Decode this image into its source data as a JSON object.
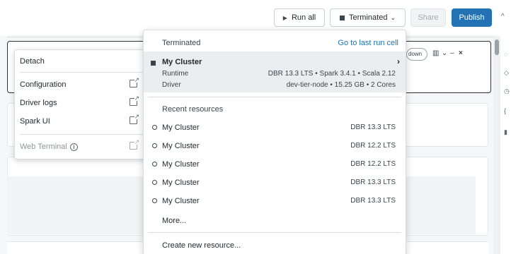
{
  "toolbar": {
    "run_all": "Run all",
    "cluster_status": "Terminated",
    "share": "Share",
    "publish": "Publish"
  },
  "attach_menu": {
    "items": [
      {
        "label": "Detach"
      },
      {
        "label": "Configuration"
      },
      {
        "label": "Driver logs"
      },
      {
        "label": "Spark UI"
      },
      {
        "label": "Web Terminal"
      }
    ]
  },
  "cluster_dropdown": {
    "status_header": "Terminated",
    "go_to_last_run": "Go to last run cell",
    "current": {
      "name": "My Cluster",
      "runtime_label": "Runtime",
      "runtime_value": "DBR 13.3 LTS • Spark 3.4.1 • Scala 2.12",
      "driver_label": "Driver",
      "driver_value": "dev-tier-node • 15.25 GB • 2 Cores"
    },
    "recent_header": "Recent resources",
    "recent": [
      {
        "name": "My Cluster",
        "version": "DBR 13.3 LTS"
      },
      {
        "name": "My Cluster",
        "version": "DBR 12.2 LTS"
      },
      {
        "name": "My Cluster",
        "version": "DBR 12.2 LTS"
      },
      {
        "name": "My Cluster",
        "version": "DBR 13.3 LTS"
      },
      {
        "name": "My Cluster",
        "version": "DBR 13.3 LTS"
      }
    ],
    "more": "More...",
    "create": "Create new resource..."
  },
  "cell": {
    "control_partial": "down"
  },
  "colors": {
    "accent": "#2272b4",
    "text": "#1f272d",
    "highlight": "#ebeef1"
  }
}
